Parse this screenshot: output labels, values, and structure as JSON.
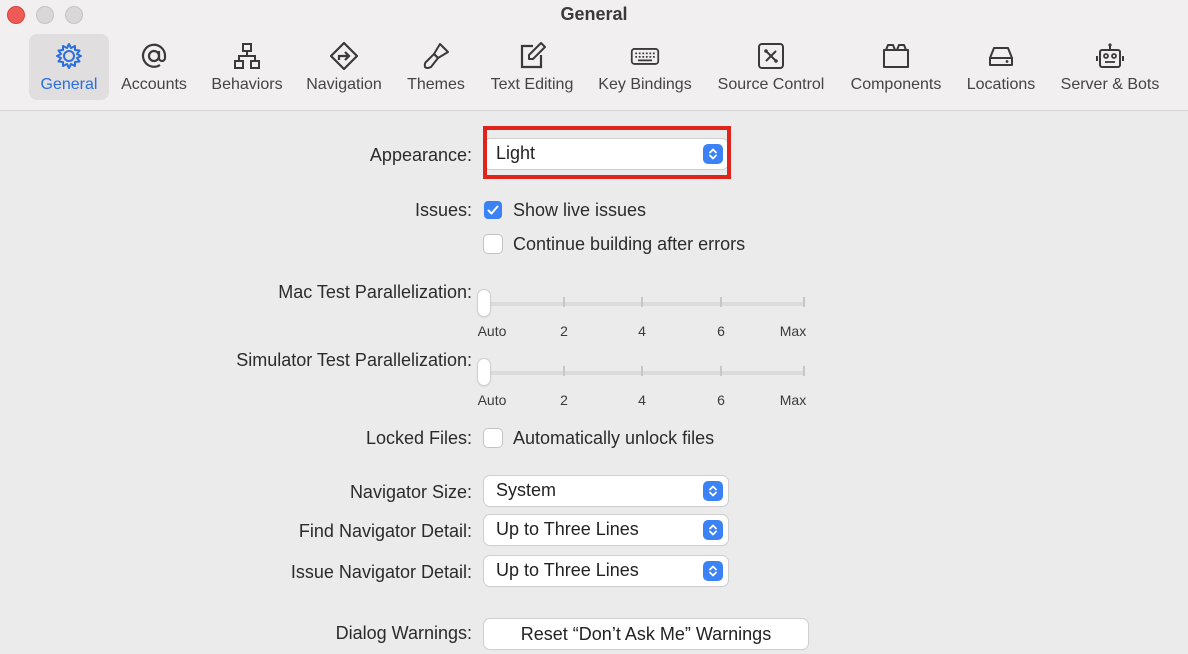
{
  "window": {
    "title": "General"
  },
  "toolbar": {
    "items": [
      {
        "label": "General",
        "icon": "gear-icon",
        "selected": true
      },
      {
        "label": "Accounts",
        "icon": "at-icon"
      },
      {
        "label": "Behaviors",
        "icon": "hierarchy-icon"
      },
      {
        "label": "Navigation",
        "icon": "navigation-arrow-icon"
      },
      {
        "label": "Themes",
        "icon": "paintbrush-icon"
      },
      {
        "label": "Text Editing",
        "icon": "pencil-square-icon"
      },
      {
        "label": "Key Bindings",
        "icon": "keyboard-icon"
      },
      {
        "label": "Source Control",
        "icon": "source-control-icon"
      },
      {
        "label": "Components",
        "icon": "folder-icon"
      },
      {
        "label": "Locations",
        "icon": "drive-icon"
      },
      {
        "label": "Server & Bots",
        "icon": "robot-icon"
      }
    ]
  },
  "form": {
    "appearance": {
      "label": "Appearance:",
      "value": "Light"
    },
    "issues": {
      "label": "Issues:",
      "show_live": {
        "label": "Show live issues",
        "checked": true
      },
      "continue_building": {
        "label": "Continue building after errors",
        "checked": false
      }
    },
    "mac_test": {
      "label": "Mac Test Parallelization:",
      "ticks": [
        "Auto",
        "2",
        "4",
        "6",
        "Max"
      ],
      "value": "Auto"
    },
    "sim_test": {
      "label": "Simulator Test Parallelization:",
      "ticks": [
        "Auto",
        "2",
        "4",
        "6",
        "Max"
      ],
      "value": "Auto"
    },
    "locked_files": {
      "label": "Locked Files:",
      "unlock": {
        "label": "Automatically unlock files",
        "checked": false
      }
    },
    "navigator_size": {
      "label": "Navigator Size:",
      "value": "System"
    },
    "find_nav": {
      "label": "Find Navigator Detail:",
      "value": "Up to Three Lines"
    },
    "issue_nav": {
      "label": "Issue Navigator Detail:",
      "value": "Up to Three Lines"
    },
    "dialog_warnings": {
      "label": "Dialog Warnings:",
      "button": "Reset “Don’t Ask Me” Warnings"
    }
  },
  "colors": {
    "accent": "#3b82f6",
    "selected_label": "#2a6fe0",
    "highlight": "#e0241b"
  }
}
